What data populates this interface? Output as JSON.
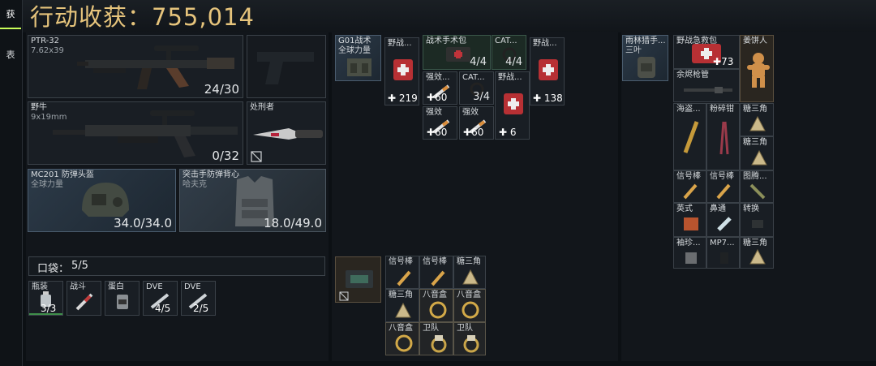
{
  "header": {
    "title": "行动收获：755,014"
  },
  "sidetabs": [
    "获",
    "表"
  ],
  "weapons": [
    {
      "name": "PTR-32",
      "caliber": "7.62x39",
      "ammo": "24/30"
    },
    {
      "name": "野牛",
      "caliber": "9x19mm",
      "ammo": "0/32"
    }
  ],
  "melee": {
    "name": "处刑者"
  },
  "armor": [
    {
      "name": "MC201 防弹头盔",
      "brand": "全球力量",
      "durability": "34.0/34.0"
    },
    {
      "name": "突击手防弹背心",
      "brand": "哈夫克",
      "durability": "18.0/49.0"
    }
  ],
  "pocket": {
    "label": "口袋：",
    "count": "5/5"
  },
  "pocket_items": [
    {
      "name": "瓶装",
      "qty": "3/3"
    },
    {
      "name": "战斗",
      "qty": ""
    },
    {
      "name": "蛋白",
      "qty": ""
    },
    {
      "name": "DVE",
      "qty": "4/5"
    },
    {
      "name": "DVE",
      "qty": "2/5"
    }
  ],
  "chest_rig": {
    "name": "G01战术",
    "brand": "全球力量"
  },
  "rig_items": [
    {
      "name": "野战...",
      "qty": "219"
    },
    {
      "name": "战术手术包",
      "qty": "4/4"
    },
    {
      "name": "CAT...",
      "qty": "4/4"
    },
    {
      "name": "野战...",
      "qty": "138"
    },
    {
      "name": "强效...",
      "qty": "60"
    },
    {
      "name": "CAT...",
      "qty": "3/4"
    },
    {
      "name": "野战...",
      "qty": "6"
    },
    {
      "name": "强效",
      "qty": "60"
    },
    {
      "name": "强效",
      "qty": "60"
    }
  ],
  "case_items": [
    {
      "name": "信号棒"
    },
    {
      "name": "信号棒"
    },
    {
      "name": "糖三角"
    },
    {
      "name": "糖三角"
    },
    {
      "name": "八音盒"
    },
    {
      "name": "八音盒"
    },
    {
      "name": "八音盒"
    },
    {
      "name": "卫队"
    },
    {
      "name": "卫队"
    }
  ],
  "backpack": {
    "name": "雨林猎手...",
    "brand": "三叶"
  },
  "backpack_items": [
    {
      "name": "野战急救包",
      "qty": "73"
    },
    {
      "name": "姜饼人"
    },
    {
      "name": "余烬枪管"
    },
    {
      "name": "海盗..."
    },
    {
      "name": "粉碎钳"
    },
    {
      "name": "糖三角"
    },
    {
      "name": "糖三角"
    },
    {
      "name": "信号棒"
    },
    {
      "name": "信号棒"
    },
    {
      "name": "图腾..."
    },
    {
      "name": "英式"
    },
    {
      "name": "鼻通"
    },
    {
      "name": "转换"
    },
    {
      "name": "袖珍..."
    },
    {
      "name": "MP7..."
    },
    {
      "name": "糖三角"
    }
  ],
  "colors": {
    "title": "#e6c47c",
    "accent": "#c9ff59",
    "panel": "#12161b"
  }
}
